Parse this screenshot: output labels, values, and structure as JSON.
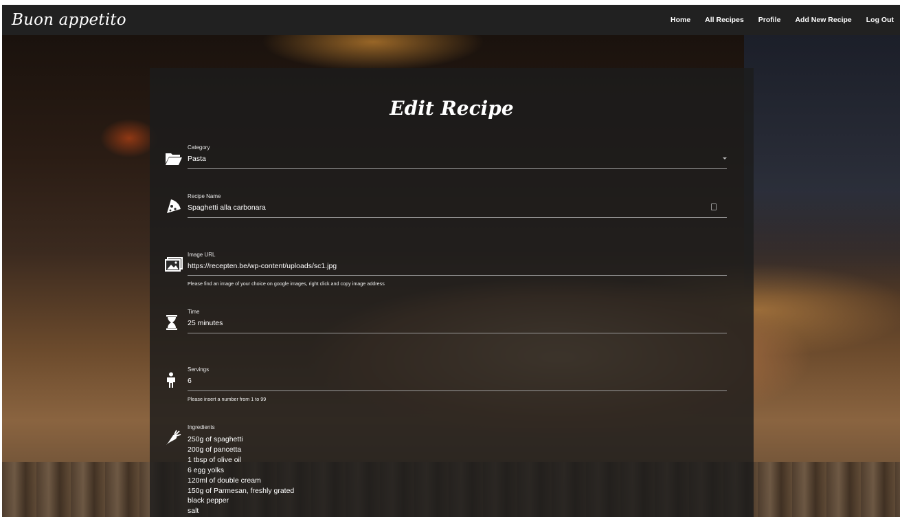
{
  "navbar": {
    "brand": "Buon appetito",
    "links": [
      "Home",
      "All Recipes",
      "Profile",
      "Add New Recipe",
      "Log Out"
    ]
  },
  "form": {
    "title": "Edit Recipe",
    "category": {
      "label": "Category",
      "value": "Pasta",
      "icon": "folder-open-icon"
    },
    "recipe_name": {
      "label": "Recipe Name",
      "value": "Spaghetti alla carbonara",
      "icon": "pizza-slice-icon"
    },
    "image_url": {
      "label": "Image URL",
      "value": "https://recepten.be/wp-content/uploads/sc1.jpg",
      "helper": "Please find an image of your choice on google images, right click and copy image address",
      "icon": "image-icon"
    },
    "time": {
      "label": "Time",
      "value": "25 minutes",
      "icon": "hourglass-icon"
    },
    "servings": {
      "label": "Servings",
      "value": "6",
      "helper": "Please insert a number from 1 to 99",
      "icon": "person-icon"
    },
    "ingredients": {
      "label": "Ingredients",
      "icon": "carrot-icon",
      "items": [
        "250g of spaghetti",
        "200g of pancetta",
        "1 tbsp of olive oil",
        "6 egg yolks",
        "120ml of double cream",
        "150g of Parmesan, freshly grated",
        "black pepper",
        "salt"
      ]
    }
  }
}
